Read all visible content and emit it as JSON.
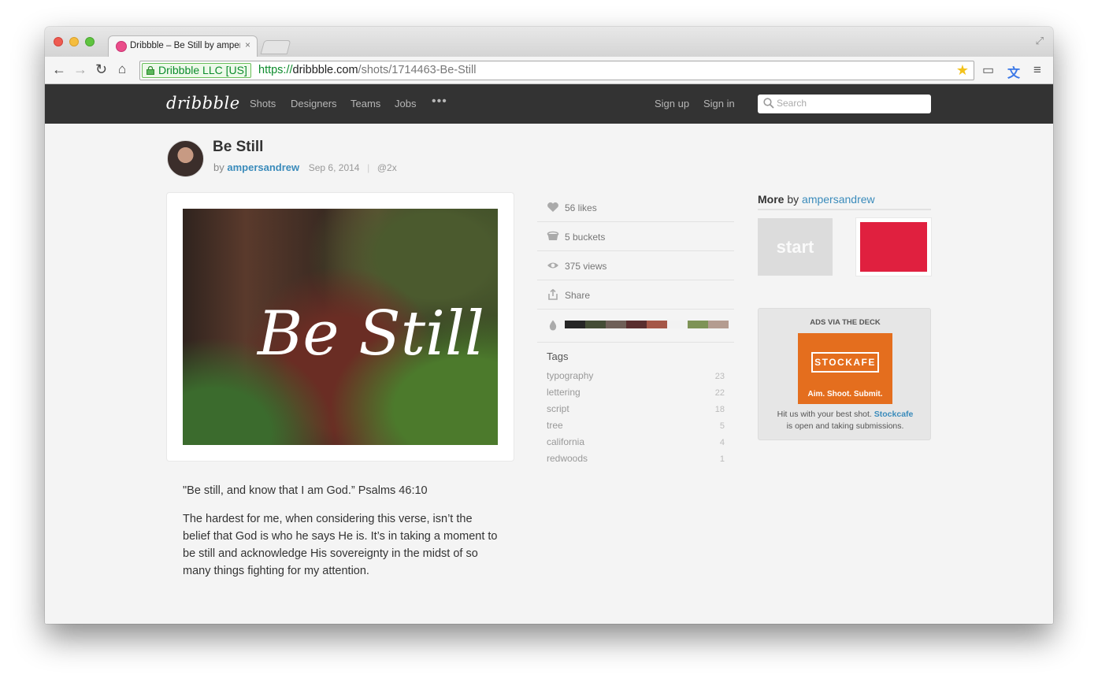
{
  "browser": {
    "tab_title": "Dribbble – Be Still by ampersandrew",
    "tab_close": "×",
    "ev_label": "Dribbble LLC [US]",
    "url_scheme": "https://",
    "url_host": "dribbble.com",
    "url_path": "/shots/1714463-Be-Still",
    "icons": [
      "back-icon",
      "forward-icon",
      "reload-icon",
      "home-icon",
      "lock-icon",
      "star-icon",
      "cast-icon",
      "translate-icon",
      "menu-icon",
      "fullscreen-icon"
    ]
  },
  "header": {
    "logo": "dribbble",
    "nav": [
      "Shots",
      "Designers",
      "Teams",
      "Jobs"
    ],
    "more": "•••",
    "sign_up": "Sign up",
    "sign_in": "Sign in",
    "search_placeholder": "Search"
  },
  "shot": {
    "title": "Be Still",
    "by": "by",
    "author": "ampersandrew",
    "date": "Sep 6, 2014",
    "sep": "|",
    "hidpi": "@2x",
    "artwork_text": "Be Still",
    "description": [
      "\"Be still, and know that I am God.” Psalms 46:10",
      "The hardest for me, when considering this verse, isn’t the belief that God is who he says He is. It’s in taking a moment to be still and acknowledge His sovereignty in the midst of so many things fighting for my attention."
    ]
  },
  "stats": {
    "likes": "56 likes",
    "buckets": "5 buckets",
    "views": "375 views",
    "share": "Share",
    "palette": [
      "#262626",
      "#444d36",
      "#6f6058",
      "#5a2f2f",
      "#a55748",
      "#f2f2f2",
      "#7e9356",
      "#b49c90"
    ],
    "tags_title": "Tags",
    "tags": [
      {
        "name": "typography",
        "count": "23"
      },
      {
        "name": "lettering",
        "count": "22"
      },
      {
        "name": "script",
        "count": "18"
      },
      {
        "name": "tree",
        "count": "5"
      },
      {
        "name": "california",
        "count": "4"
      },
      {
        "name": "redwoods",
        "count": "1"
      }
    ]
  },
  "more": {
    "label": "More",
    "by": "by",
    "author": "ampersandrew",
    "thumb1_text": "start",
    "thumb2_color": "#e0203f"
  },
  "ad": {
    "heading": "ADS VIA THE DECK",
    "logo_text": "STOCKAFE",
    "tagline": "Aim. Shoot. Submit.",
    "text_before": "Hit us with your best shot.",
    "brand": "Stockcafe",
    "text_after": "is open and taking submissions.",
    "color": "#e46e1e"
  }
}
